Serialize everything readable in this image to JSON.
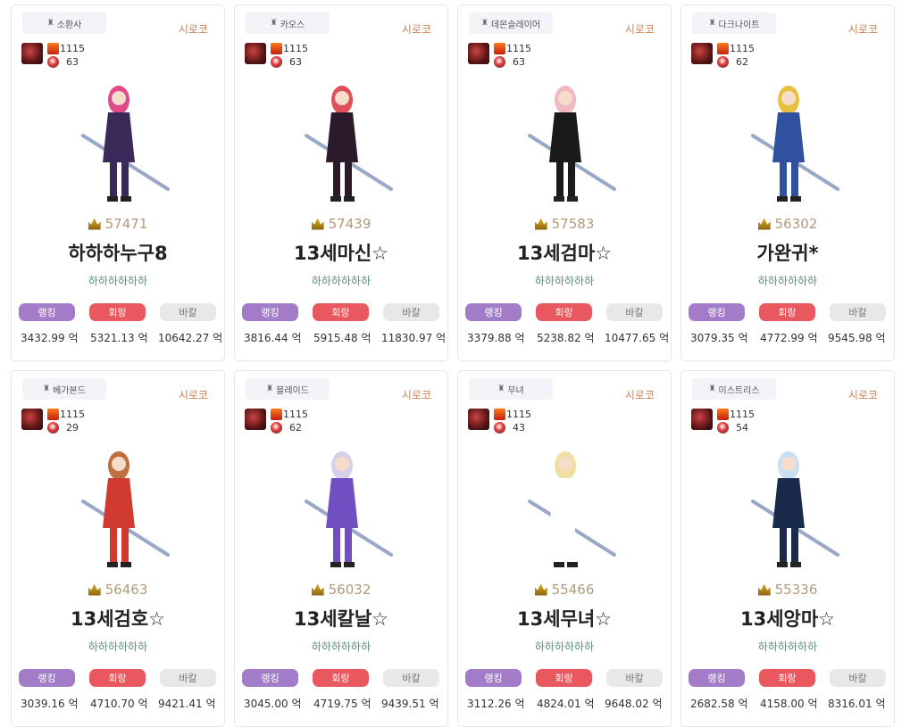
{
  "cards": [
    {
      "job": "소환사",
      "server": "시로코",
      "level": "1115",
      "pet": "63",
      "score": "57471",
      "name": "하하하누구8",
      "adventure": "하하하하하하",
      "buttons": {
        "rank": "랭킹",
        "buff": "회랑",
        "bakal": "바칼"
      },
      "values": [
        "3432.99 억",
        "5321.13 억",
        "10642.27 억"
      ],
      "char_color": "#e04a8a",
      "char_accent": "#3a2a5a"
    },
    {
      "job": "카오스",
      "server": "시로코",
      "level": "1115",
      "pet": "63",
      "score": "57439",
      "name": "13세마신☆",
      "adventure": "하하하하하하",
      "buttons": {
        "rank": "랭킹",
        "buff": "회랑",
        "bakal": "바칼"
      },
      "values": [
        "3816.44 억",
        "5915.48 억",
        "11830.97 억"
      ],
      "char_color": "#e0505a",
      "char_accent": "#2a1a2a"
    },
    {
      "job": "데몬슬레이어",
      "server": "시로코",
      "level": "1115",
      "pet": "63",
      "score": "57583",
      "name": "13세검마☆",
      "adventure": "하하하하하하",
      "buttons": {
        "rank": "랭킹",
        "buff": "회랑",
        "bakal": "바칼"
      },
      "values": [
        "3379.88 억",
        "5238.82 억",
        "10477.65 억"
      ],
      "char_color": "#f0b8c0",
      "char_accent": "#1a1a1a"
    },
    {
      "job": "다크나이트",
      "server": "시로코",
      "level": "1115",
      "pet": "62",
      "score": "56302",
      "name": "가완귀*",
      "adventure": "하하하하하하",
      "buttons": {
        "rank": "랭킹",
        "buff": "회랑",
        "bakal": "바칼"
      },
      "values": [
        "3079.35 억",
        "4772.99 억",
        "9545.98 억"
      ],
      "char_color": "#e8c040",
      "char_accent": "#3050a0"
    },
    {
      "job": "베가본드",
      "server": "시로코",
      "level": "1115",
      "pet": "29",
      "score": "56463",
      "name": "13세검호☆",
      "adventure": "하하하하하하",
      "buttons": {
        "rank": "랭킹",
        "buff": "회랑",
        "bakal": "바칼"
      },
      "values": [
        "3039.16 억",
        "4710.70 억",
        "9421.41 억"
      ],
      "char_color": "#c07040",
      "char_accent": "#d03a30"
    },
    {
      "job": "블레이드",
      "server": "시로코",
      "level": "1115",
      "pet": "62",
      "score": "56032",
      "name": "13세칼날☆",
      "adventure": "하하하하하하",
      "buttons": {
        "rank": "랭킹",
        "buff": "회랑",
        "bakal": "바칼"
      },
      "values": [
        "3045.00 억",
        "4719.75 억",
        "9439.51 억"
      ],
      "char_color": "#d8d0e8",
      "char_accent": "#7050c0"
    },
    {
      "job": "무녀",
      "server": "시로코",
      "level": "1115",
      "pet": "43",
      "score": "55466",
      "name": "13세무녀☆",
      "adventure": "하하하하하하",
      "buttons": {
        "rank": "랭킹",
        "buff": "회랑",
        "bakal": "바칼"
      },
      "values": [
        "3112.26 억",
        "4824.01 억",
        "9648.02 억"
      ],
      "char_color": "#f0e0a0",
      "char_accent": "#ffffff"
    },
    {
      "job": "미스트리스",
      "server": "시로코",
      "level": "1115",
      "pet": "54",
      "score": "55336",
      "name": "13세앙마☆",
      "adventure": "하하하하하하",
      "buttons": {
        "rank": "랭킹",
        "buff": "회랑",
        "bakal": "바칼"
      },
      "values": [
        "2682.58 억",
        "4158.00 억",
        "8316.01 억"
      ],
      "char_color": "#c8e0f0",
      "char_accent": "#1a2a4a"
    }
  ]
}
